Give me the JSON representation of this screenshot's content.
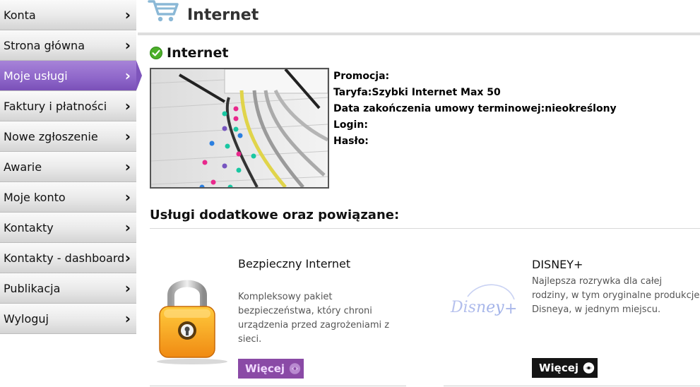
{
  "sidebar": {
    "items": [
      {
        "label": "Konta",
        "active": false
      },
      {
        "label": "Strona główna",
        "active": false
      },
      {
        "label": "Moje usługi",
        "active": true
      },
      {
        "label": "Faktury i płatności",
        "active": false
      },
      {
        "label": "Nowe zgłoszenie",
        "active": false
      },
      {
        "label": "Awarie",
        "active": false
      },
      {
        "label": "Moje konto",
        "active": false
      },
      {
        "label": "Kontakty",
        "active": false
      },
      {
        "label": "Kontakty - dashboard",
        "active": false
      },
      {
        "label": "Publikacja",
        "active": false
      },
      {
        "label": "Wyloguj",
        "active": false
      }
    ],
    "chevron": "›",
    "active_color": "#8e66c9"
  },
  "header": {
    "title": "Internet",
    "icon": "shopping-cart-icon",
    "icon_color": "#8ab8d6"
  },
  "service": {
    "title": "Internet",
    "status_icon": "check-circle-icon",
    "status_color": "#4caf2a",
    "image": "router-with-cables-photo",
    "details": {
      "promo_label": "Promocja:",
      "promo_value": "",
      "tariff_label": "Taryfa:",
      "tariff_value": "Szybki Internet Max 50",
      "contract_label": "Data zakończenia umowy terminowej:",
      "contract_value": "nieokreślony",
      "login_label": "Login:",
      "login_value": "",
      "password_label": "Hasło:",
      "password_value": ""
    }
  },
  "additional": {
    "heading": "Usługi dodatkowe oraz powiązane:",
    "cards": [
      {
        "title": "Bezpieczny Internet",
        "description": "Kompleksowy pakiet bezpieczeństwa, który chroni urządzenia przed zagrożeniami z sieci.",
        "button": "Więcej",
        "image": "padlock-icon",
        "button_color": "#8a4aa6"
      },
      {
        "title": "DISNEY+",
        "description": "Najlepsza rozrywka dla całej rodziny, w tym oryginalne produkcje Disneya, w jednym miejscu.",
        "button": "Więcej",
        "image": "disney-plus-logo",
        "button_color": "#141414"
      }
    ]
  }
}
